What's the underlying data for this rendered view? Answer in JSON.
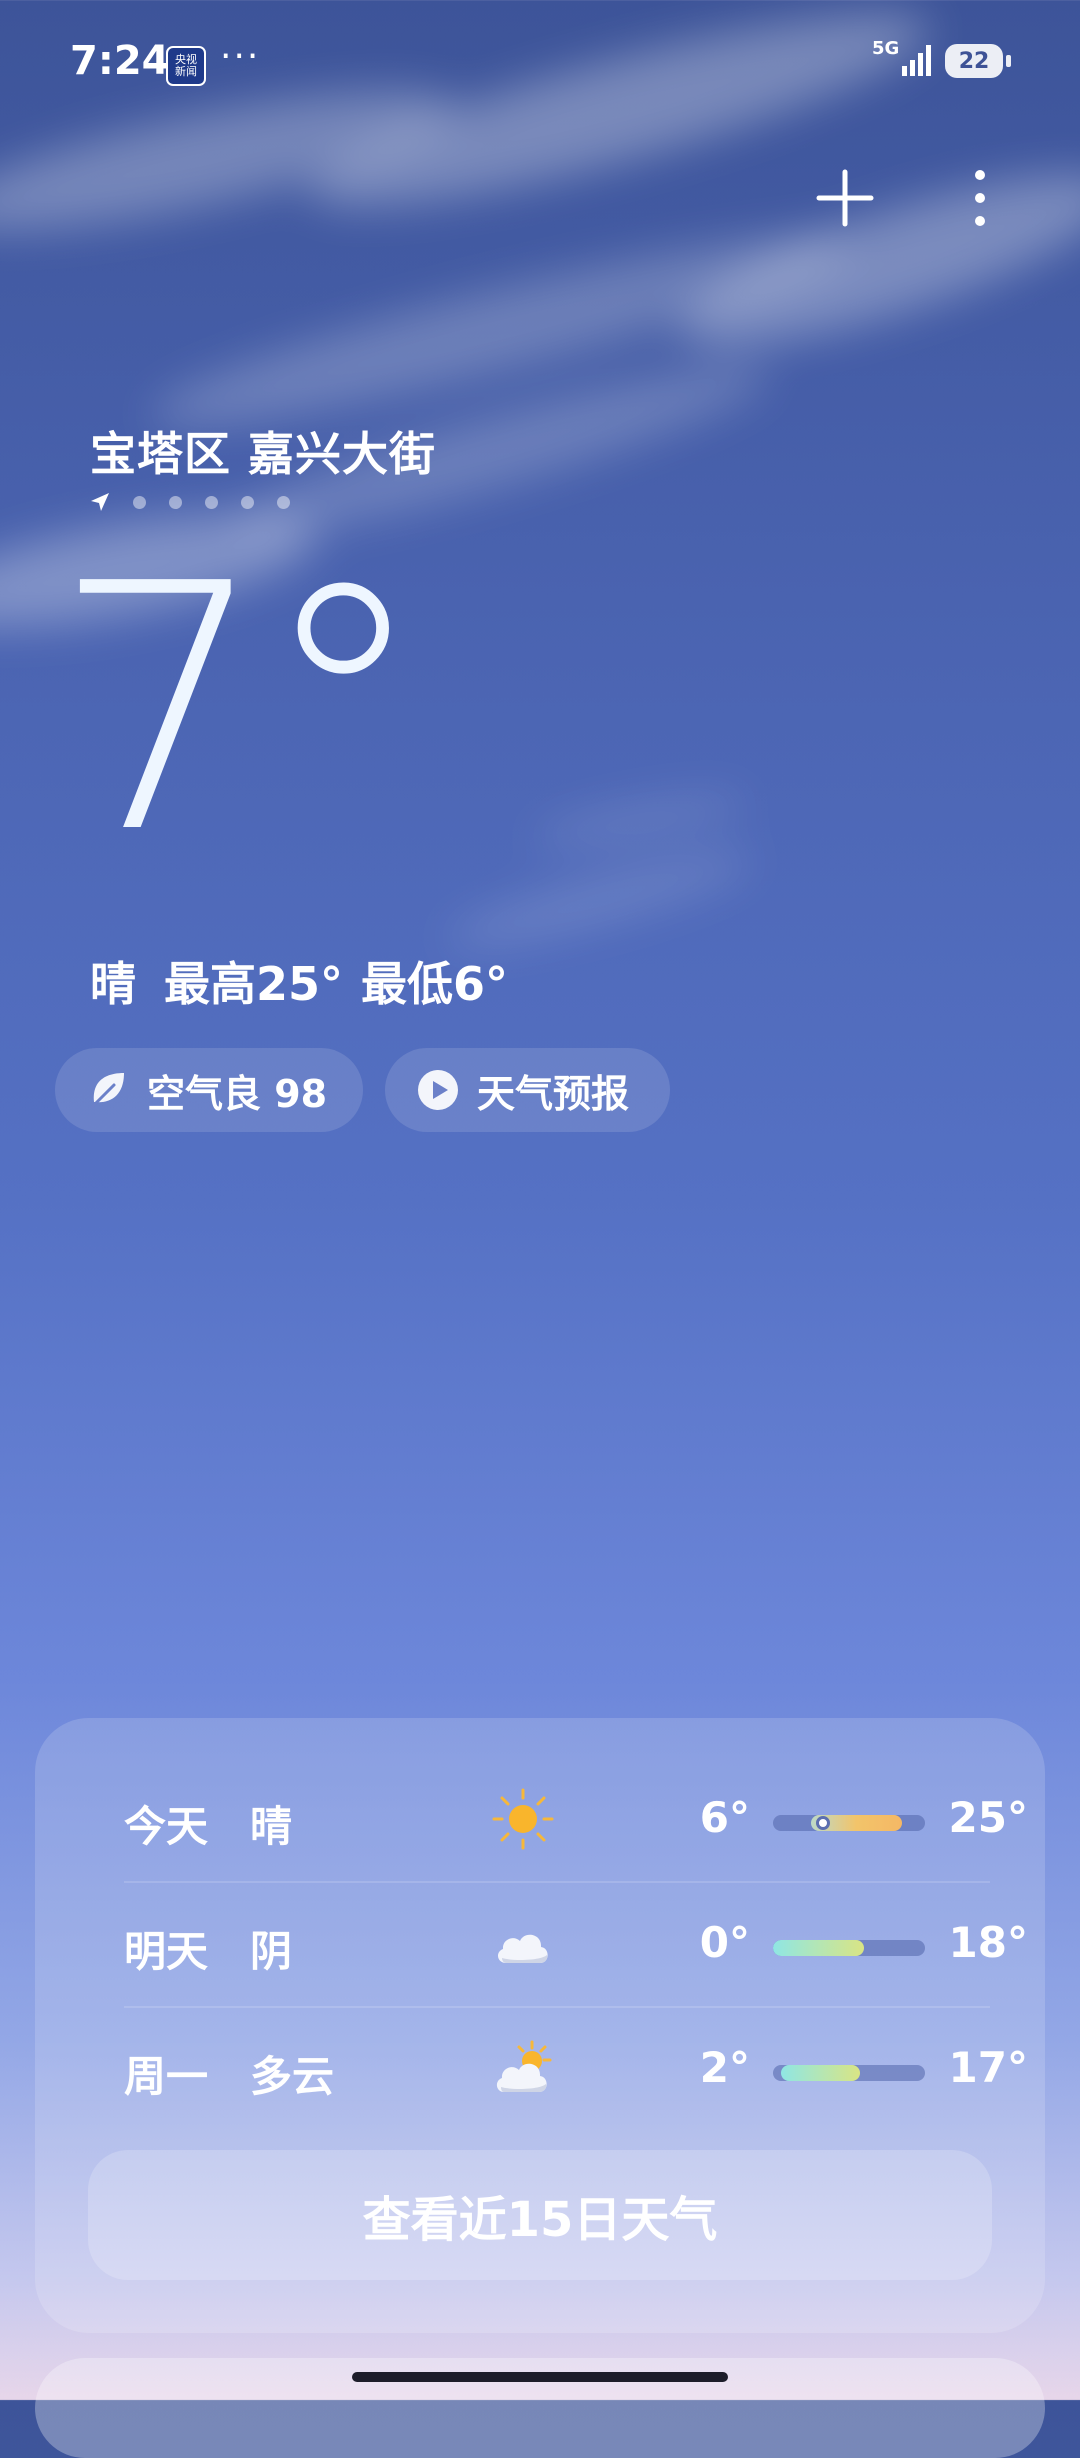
{
  "status_bar": {
    "time": "7:24",
    "news_badge": "央视\n新闻",
    "more_dots": "···",
    "network": "5G",
    "battery": "22"
  },
  "location": {
    "name": "宝塔区 嘉兴大街",
    "page_count": 6,
    "current_page": 1
  },
  "current": {
    "temperature": "7°",
    "condition": "晴",
    "high": "最高25°",
    "low": "最低6°"
  },
  "chips": {
    "air_quality": "空气良 98",
    "forecast": "天气预报"
  },
  "forecast": [
    {
      "day": "今天",
      "condition": "晴",
      "icon": "sun-icon",
      "low": "6°",
      "high": "25°",
      "range_start": 0.25,
      "range_end": 0.85,
      "current_marker": 0.28
    },
    {
      "day": "明天",
      "condition": "阴",
      "icon": "cloud-icon",
      "low": "0°",
      "high": "18°",
      "range_start": 0.0,
      "range_end": 0.6
    },
    {
      "day": "周一",
      "condition": "多云",
      "icon": "partly-cloudy-icon",
      "low": "2°",
      "high": "17°",
      "range_start": 0.05,
      "range_end": 0.57
    }
  ],
  "view_15_day": "查看近15日天气",
  "colors": {
    "bar_today": "#f2c46a",
    "bar_warm": "#d9e584",
    "bar_cool": "#8fe6e4"
  }
}
